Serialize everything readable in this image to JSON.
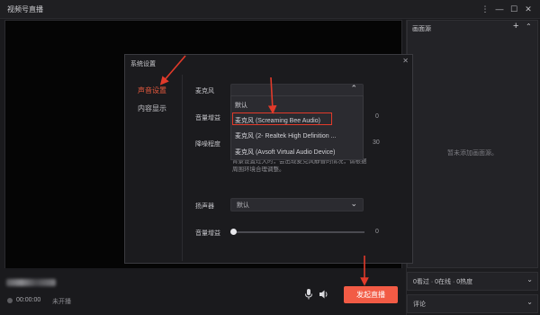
{
  "app": {
    "title": "视频号直播",
    "win_controls": {
      "more": "⋮",
      "minimize": "—",
      "maximize": "☐",
      "close": "✕"
    }
  },
  "preview": {
    "status_time": "00:00:00",
    "status_text": "未开播",
    "go_live_label": "发起直播",
    "mic_icon": "microphone-icon",
    "speaker_icon": "speaker-icon"
  },
  "right_panel": {
    "scene_title": "画面源",
    "add": "+",
    "collapse": "⌃",
    "empty_text": "暂未添加画面源。",
    "stats_text": "0看过 · 0在线 · 0热度",
    "comments_text": "评论"
  },
  "dialog": {
    "title": "系统设置",
    "close": "✕",
    "sidebar": [
      {
        "label": "声音设置",
        "active": true
      },
      {
        "label": "内容显示",
        "active": false
      }
    ],
    "microphone": {
      "label": "麦克风",
      "gain_label": "音量增益",
      "gain_value": "0",
      "noise_label": "降噪程度",
      "noise_value": "30",
      "hint_text": "背景设置过大时，会出现麦克风静音的情况，请根据周围环境合理调整。",
      "options": [
        "默认",
        "麦克风 (Screaming Bee Audio)",
        "麦克风 (2- Realtek High Definition ...",
        "麦克风 (Avsoft Virtual Audio Device)"
      ]
    },
    "speaker": {
      "label": "扬声器",
      "selected": "默认",
      "gain_label": "音量增益",
      "gain_value": "0",
      "gain_level_percent": 0
    }
  },
  "annotations": {
    "highlight_color": "#e23a2a"
  }
}
